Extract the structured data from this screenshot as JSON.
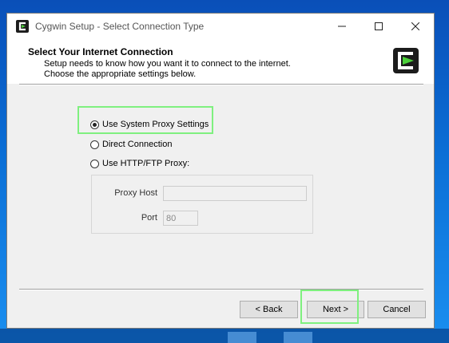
{
  "window": {
    "title": "Cygwin Setup - Select Connection Type",
    "app_icon": "cygwin-icon"
  },
  "header": {
    "title": "Select Your Internet Connection",
    "subtitle": "Setup needs to know how you want it to connect to the internet.  Choose the appropriate settings below.",
    "logo": "cygwin-logo"
  },
  "options": [
    {
      "label": "Use System Proxy Settings",
      "checked": true
    },
    {
      "label": "Direct Connection",
      "checked": false
    },
    {
      "label": "Use HTTP/FTP Proxy:",
      "checked": false
    }
  ],
  "proxy": {
    "host_label": "Proxy Host",
    "host_value": "",
    "port_label": "Port",
    "port_value": "80"
  },
  "buttons": {
    "back": "< Back",
    "next": "Next >",
    "cancel": "Cancel"
  },
  "colors": {
    "highlight": "#7ff07f",
    "logo_green": "#4cd13a",
    "desktop_blue": "#0b6fd6"
  }
}
